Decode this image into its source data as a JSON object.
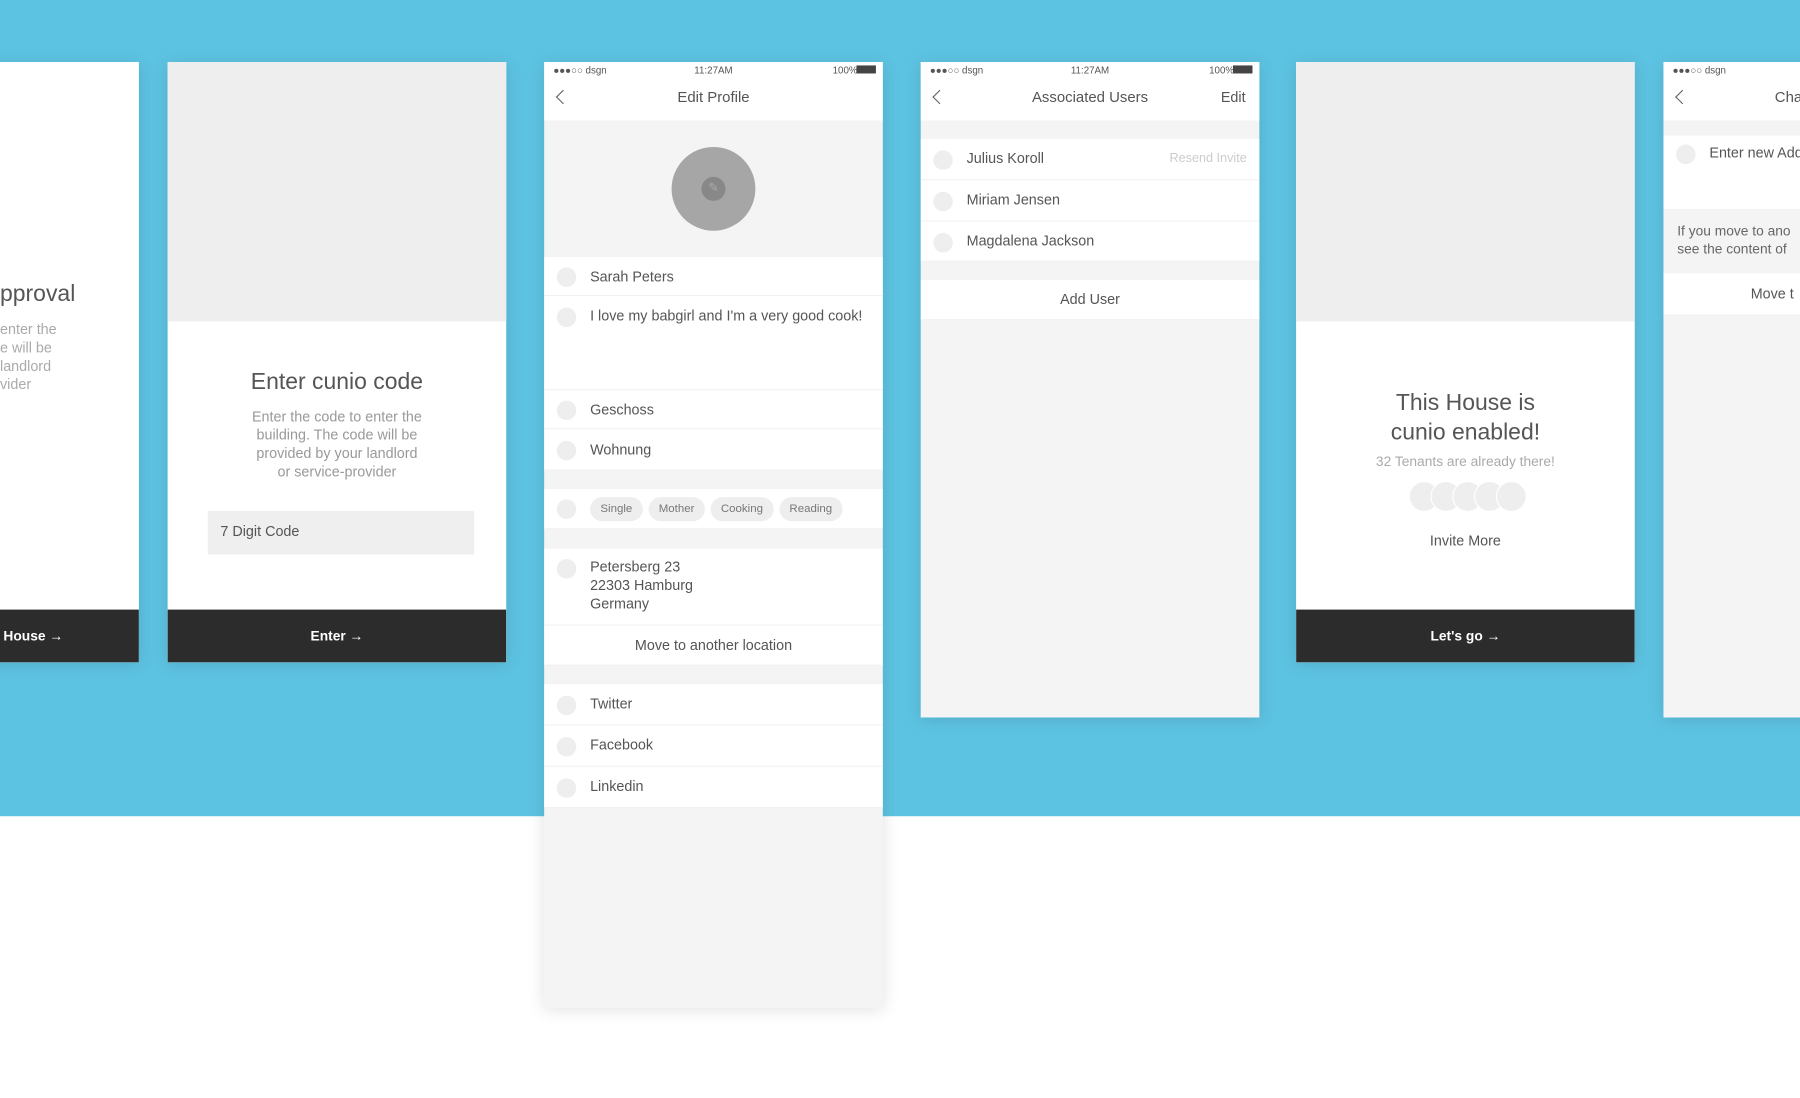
{
  "colors": {
    "background": "#5dc3e2",
    "button": "#2c2c2c",
    "placeholder_gray": "#eeeeee"
  },
  "status_bar": {
    "carrier": "●●●○○ dsgn",
    "time": "11:27AM",
    "battery": "100%",
    "wifi_icon": "wifi-icon",
    "battery_icon": "battery-icon"
  },
  "screen_approval": {
    "title_fragment": "pproval",
    "body_lines": [
      "enter the",
      "e will be",
      "landlord",
      "vider"
    ],
    "button": "House →"
  },
  "screen_code": {
    "title": "Enter cunio code",
    "body_lines": [
      "Enter the code to enter the",
      "building. The code will be",
      "provided by your landlord",
      "or service-provider"
    ],
    "input_placeholder": "7 Digit Code",
    "button": "Enter →"
  },
  "screen_edit_profile": {
    "title": "Edit Profile",
    "name": "Sarah Peters",
    "bio": "I love my babgirl and I'm a very good cook!",
    "floor": "Geschoss",
    "apartment": "Wohnung",
    "tags": [
      "Single",
      "Mother",
      "Cooking",
      "Reading"
    ],
    "address": [
      "Petersberg 23",
      "22303 Hamburg",
      "Germany"
    ],
    "move_button": "Move to another location",
    "social": [
      "Twitter",
      "Facebook",
      "Linkedin"
    ]
  },
  "screen_users": {
    "title": "Associated Users",
    "edit": "Edit",
    "users": [
      {
        "name": "Julius Koroll",
        "action": "Resend Invite"
      },
      {
        "name": "Miriam Jensen"
      },
      {
        "name": "Magdalena Jackson"
      }
    ],
    "add_user": "Add User"
  },
  "screen_house": {
    "title_lines": [
      "This House is",
      "cunio enabled!"
    ],
    "subtitle": "32 Tenants are already there!",
    "invite": "Invite More",
    "button": "Let's go →"
  },
  "screen_change": {
    "title_fragment": "Cha",
    "input_fragment": "Enter new Add",
    "info_lines": [
      "If you move to ano",
      "see the content of"
    ],
    "button_fragment": "Move t"
  }
}
